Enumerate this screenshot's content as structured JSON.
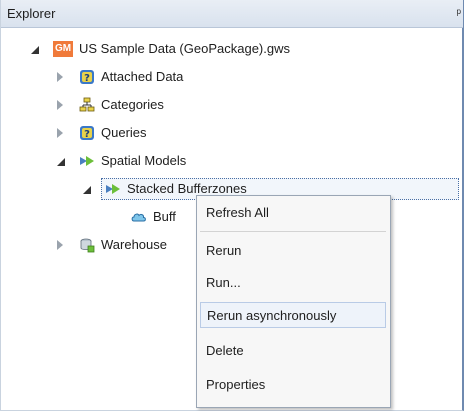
{
  "panel": {
    "title": "Explorer",
    "pin_glyph": "ᵖ"
  },
  "tree": {
    "root": {
      "badge": "GM",
      "label": "US Sample Data (GeoPackage).gws"
    },
    "attached_data": {
      "label": "Attached Data"
    },
    "categories": {
      "label": "Categories"
    },
    "queries": {
      "label": "Queries"
    },
    "spatial_models": {
      "label": "Spatial Models"
    },
    "stacked_bufferzones": {
      "label": "Stacked Bufferzones"
    },
    "buff_child": {
      "label": "Buff"
    },
    "warehouse": {
      "label": "Warehouse"
    }
  },
  "context_menu": {
    "refresh_all": "Refresh All",
    "rerun": "Rerun",
    "run": "Run...",
    "rerun_async": "Rerun asynchronously",
    "delete": "Delete",
    "properties": "Properties"
  },
  "colors": {
    "accent": "#6f8ab0",
    "gm_badge": "#f07a3a",
    "help_icon": "#3a78c8"
  }
}
